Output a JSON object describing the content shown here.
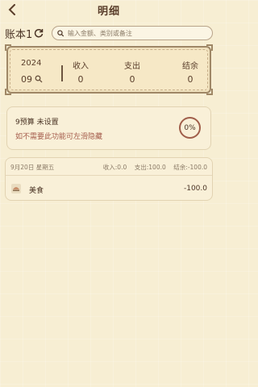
{
  "header": {
    "title": "明细"
  },
  "book": {
    "name": "账本1"
  },
  "search": {
    "placeholder": "输入金额、类别或备注"
  },
  "summary": {
    "year": "2024",
    "month": "09",
    "income_label": "收入",
    "income_value": "0",
    "expense_label": "支出",
    "expense_value": "0",
    "balance_label": "结余",
    "balance_value": "0"
  },
  "budget": {
    "title": "9预算 未设置",
    "hint": "如不需要此功能可左滑隐藏",
    "percent": "0%"
  },
  "day_group": {
    "date": "9月20日 星期五",
    "stats": "收入:0.0    支出:100.0    结余:-100.0",
    "entry": {
      "icon": "food-icon",
      "category": "美食",
      "amount": "-100.0"
    }
  },
  "colors": {
    "background": "#f7eed3",
    "card_border": "#9f8766",
    "accent_red": "#a05e4a",
    "text": "#5a3e2b"
  }
}
